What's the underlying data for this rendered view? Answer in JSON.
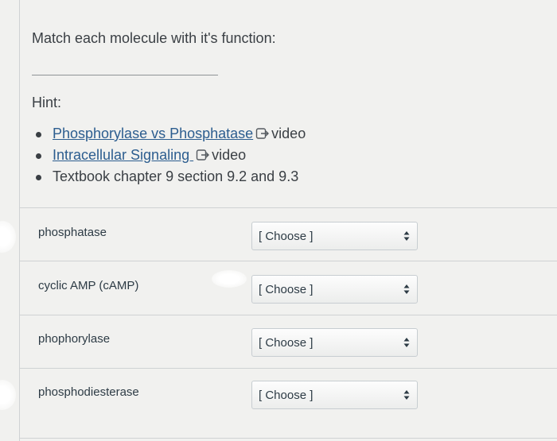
{
  "question": "Match each molecule with it's function:",
  "hint": {
    "label": "Hint:",
    "items": [
      {
        "link": "Phosphorylase vs Phosphatase",
        "suffix": "video"
      },
      {
        "link": "Intracellular Signaling ",
        "suffix": "video"
      },
      {
        "text": "Textbook chapter 9 section 9.2 and 9.3"
      }
    ]
  },
  "matches": [
    {
      "label": "phosphatase",
      "selected": "[ Choose ]"
    },
    {
      "label": "cyclic AMP (cAMP)",
      "selected": "[ Choose ]"
    },
    {
      "label": "phophorylase",
      "selected": "[ Choose ]"
    },
    {
      "label": "phosphodiesterase",
      "selected": "[ Choose ]"
    }
  ],
  "icons": {
    "external_link": "external-link-icon",
    "select_arrows": "updown-arrows-icon"
  },
  "colors": {
    "link": "#2c5d8f",
    "text": "#2d3b45"
  }
}
